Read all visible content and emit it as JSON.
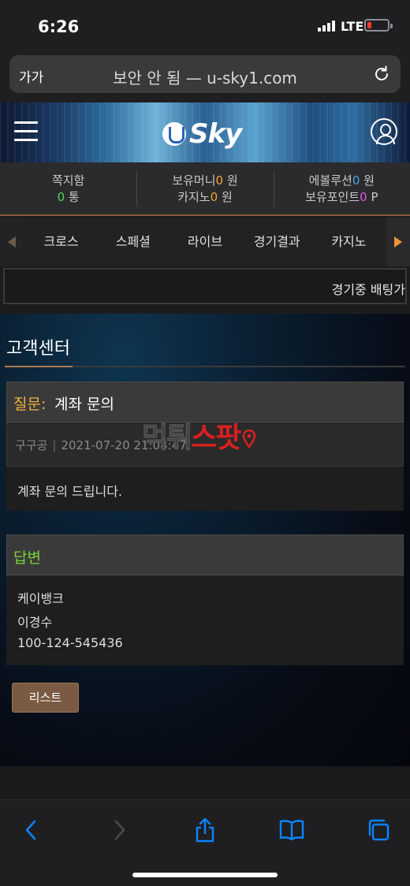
{
  "status_bar": {
    "time": "6:26",
    "network": "LTE"
  },
  "browser": {
    "text_size_label": "가가",
    "url_text": "보안 안 됨 — u-sky1.com"
  },
  "site": {
    "logo_text": "Sky",
    "info": {
      "messages_label": "쪽지함",
      "messages_count": "0",
      "messages_unit": "통",
      "money_label": "보유머니",
      "money_value": "0",
      "money_unit": "원",
      "casino_label": "카지노",
      "casino_value": "0",
      "casino_unit": "원",
      "evolution_label": "에볼루션",
      "evolution_value": "0",
      "evolution_unit": "원",
      "points_label": "보유포인트",
      "points_value": "0",
      "points_unit": "P"
    },
    "nav_tabs": [
      "크로스",
      "스페셜",
      "라이브",
      "경기결과",
      "카지노"
    ],
    "ticker": "경기중 배팅가"
  },
  "page": {
    "title": "고객센터",
    "question_label": "질문:",
    "question_title": "계좌 문의",
    "author": "구구공",
    "date": "2021-07-20 21:04:47",
    "question_body": "계좌 문의 드립니다.",
    "answer_label": "답변",
    "answer_lines": [
      "케이뱅크",
      "이경수",
      "100-124-545436"
    ],
    "list_button": "리스트"
  },
  "watermark": {
    "dark_text": "먹튀",
    "red_text": "스팟"
  },
  "colors": {
    "accent_orange": "#f0b43a",
    "answer_green": "#7ad23a",
    "button_brown": "#7a5a42",
    "ios_blue": "#0a84ff"
  }
}
